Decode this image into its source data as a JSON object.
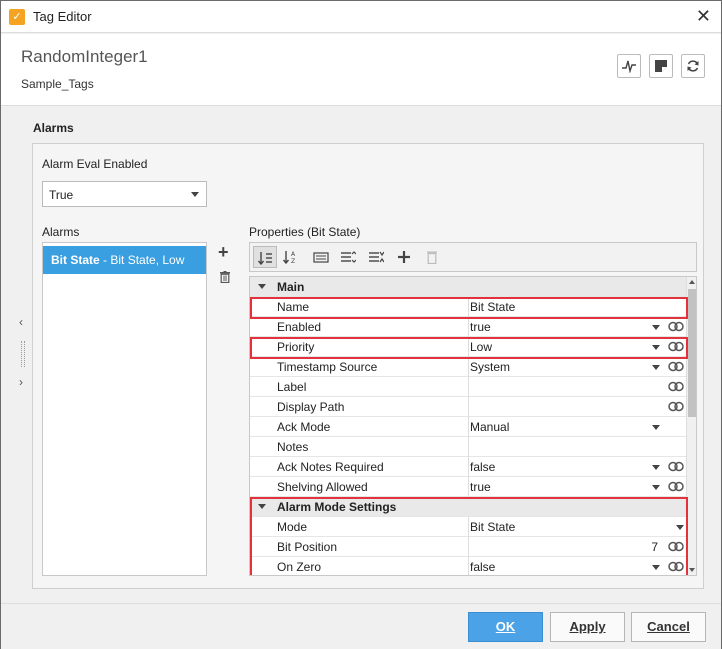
{
  "window": {
    "title": "Tag Editor"
  },
  "header": {
    "tag_name": "RandomInteger1",
    "tag_provider": "Sample_Tags"
  },
  "section": {
    "title": "Alarms"
  },
  "alarm_eval": {
    "label": "Alarm Eval Enabled",
    "value": "True"
  },
  "alarms": {
    "label": "Alarms",
    "items": [
      {
        "name": "Bit State",
        "detail": " - Bit State, Low"
      }
    ]
  },
  "properties": {
    "label": "Properties (Bit State)",
    "rows": [
      {
        "type": "category",
        "name": "Main"
      },
      {
        "name": "Name",
        "value": "Bit State"
      },
      {
        "name": "Enabled",
        "value": "true"
      },
      {
        "name": "Priority",
        "value": "Low"
      },
      {
        "name": "Timestamp Source",
        "value": "System"
      },
      {
        "name": "Label",
        "value": ""
      },
      {
        "name": "Display Path",
        "value": ""
      },
      {
        "name": "Ack Mode",
        "value": "Manual"
      },
      {
        "name": "Notes",
        "value": ""
      },
      {
        "name": "Ack Notes Required",
        "value": "false"
      },
      {
        "name": "Shelving Allowed",
        "value": "true"
      },
      {
        "type": "category",
        "name": "Alarm Mode Settings"
      },
      {
        "name": "Mode",
        "value": "Bit State"
      },
      {
        "name": "Bit Position",
        "value": "7"
      },
      {
        "name": "On Zero",
        "value": "false"
      }
    ]
  },
  "footer": {
    "ok": "OK",
    "apply": "Apply",
    "cancel": "Cancel"
  },
  "colors": {
    "accent": "#4ba2e6",
    "selection": "#3a9fe0",
    "highlight": "#e2323c"
  }
}
